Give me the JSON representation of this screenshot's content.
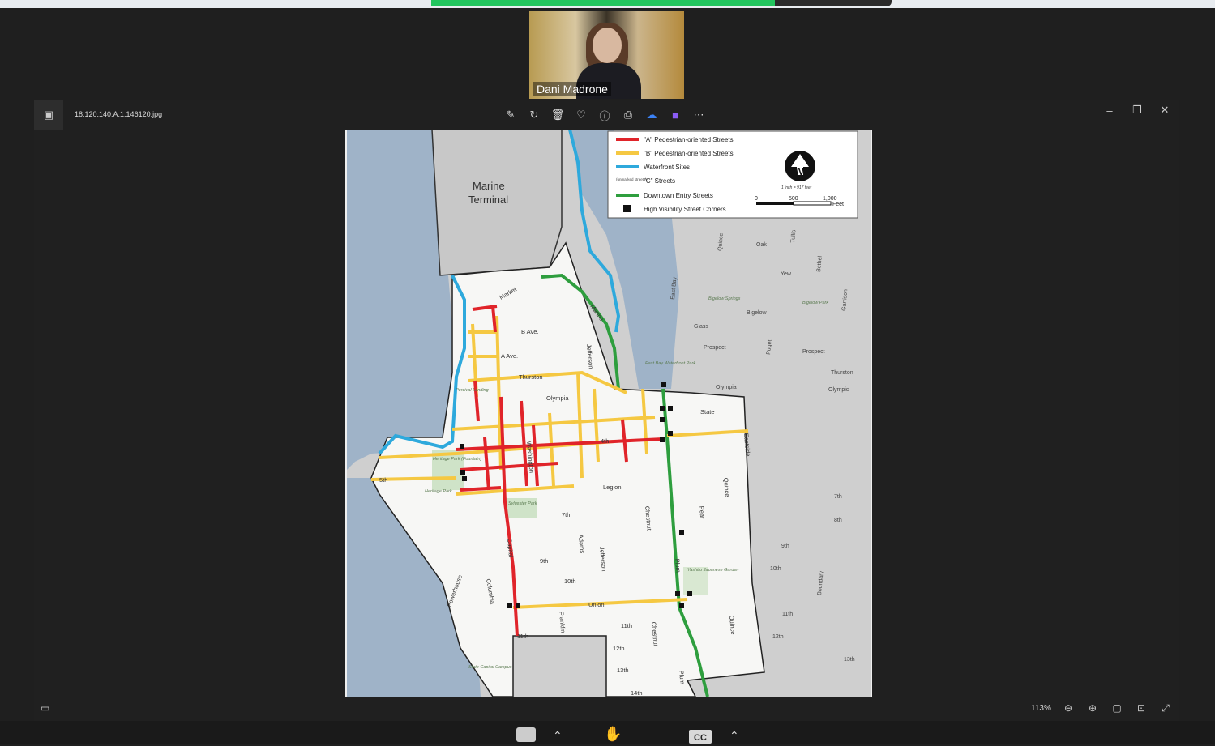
{
  "meeting": {
    "participant_name": "Dani Madrone"
  },
  "viewer": {
    "filename": "18.120.140.A.1.146120.jpg",
    "zoom": "113%"
  },
  "map": {
    "legend": {
      "a_streets": "\"A\" Pedestrian-oriented Streets",
      "b_streets": "\"B\" Pedestrian-oriented Streets",
      "waterfront": "Waterfront Sites",
      "unmarked": "(unmarked streets)",
      "c_streets": "\"C\" Streets",
      "entry": "Downtown Entry Streets",
      "corners": "High Visibility Street Corners",
      "scale_note": "1 inch = 917 feet",
      "scale_0": "0",
      "scale_500": "500",
      "scale_1000": "1,000",
      "scale_unit": "Feet"
    },
    "labels": {
      "marine_terminal_1": "Marine",
      "marine_terminal_2": "Terminal",
      "market": "Market",
      "marine": "Marine",
      "b_ave": "B Ave.",
      "a_ave": "A Ave.",
      "thurston": "Thurston",
      "olympia": "Olympia",
      "jefferson": "Jefferson",
      "washington": "Washington",
      "fourth": "4th",
      "state": "State",
      "legion": "Legion",
      "fifth": "5th",
      "seventh": "7th",
      "chestnut": "Chestnut",
      "pear": "Pear",
      "quince": "Quince",
      "plum": "Plum",
      "adams": "Adams",
      "capitol": "Capitol",
      "columbia": "Columbia",
      "ninth": "9th",
      "tenth": "10th",
      "union": "Union",
      "eleventh": "11th",
      "twelfth": "12th",
      "thirteenth": "13th",
      "fourteenth": "14th",
      "franklin": "Franklin",
      "powerhouse": "Powerhouse",
      "eastside": "Eastside",
      "east_bay": "East Bay",
      "oak": "Oak",
      "yew": "Yew",
      "bigelow": "Bigelow",
      "glass": "Glass",
      "prospect": "Prospect",
      "prospect2": "Prospect",
      "thurston2": "Thurston",
      "olympia2": "Olympic",
      "olympia3": "Olympia",
      "boundary": "Boundary",
      "heritage_park": "Heritage Park",
      "sylvester_park": "Sylvester Park",
      "state_capitol": "State Capitol Campus",
      "yashiro": "Yashiro Japanese Garden",
      "east_bay_park": "East Bay Waterfront Park",
      "bigelow_springs": "Bigelow Springs",
      "bigelow_park": "Bigelow Park",
      "percival": "Percival Landing",
      "heritage_fountain": "Heritage Park (Fountain)",
      "quince2": "Quince",
      "tullis": "Tullis",
      "bethel": "Bethel",
      "garrison": "Garrison",
      "puget": "Puget",
      "quince3": "Quince",
      "seventh_e": "7th",
      "eighth_e": "8th",
      "ninth_e": "9th",
      "tenth_e": "10th",
      "eleventh_e": "11th",
      "twelfth_e": "12th",
      "thirteenth_e": "13th"
    },
    "colors": {
      "a": "#e0242a",
      "b": "#f5c842",
      "waterfront": "#2ea9dc",
      "entry": "#2e9e3e",
      "water": "#9fb3c8",
      "land": "#cfcfcf",
      "downtown": "#f7f7f5"
    }
  },
  "icons": {
    "app": "image-icon",
    "edit": "edit-icon",
    "rotate": "rotate-icon",
    "delete": "trash-icon",
    "favorite": "heart-icon",
    "info": "info-icon",
    "print": "print-icon",
    "cloud": "cloud-icon",
    "clipchamp": "clipchamp-icon",
    "more": "more-icon"
  },
  "bottom": {
    "cc": "CC"
  }
}
